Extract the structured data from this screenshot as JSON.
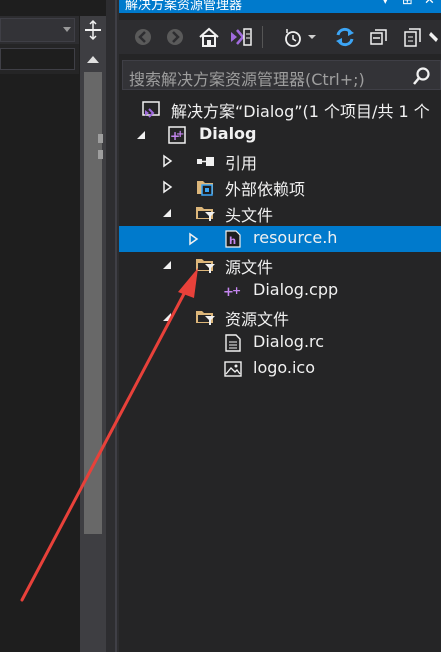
{
  "solution_explorer": {
    "title": "解决方案资源管理器",
    "title_controls": [
      "▾",
      "⊞",
      "✕"
    ],
    "search": {
      "placeholder": "搜索解决方案资源管理器(Ctrl+;)"
    },
    "tree": [
      {
        "label": "解决方案“Dialog”(1 个项目/共 1 个",
        "icon": "solution-icon"
      },
      {
        "label": "Dialog",
        "icon": "cpp-project-icon",
        "expanded": true
      },
      {
        "label": "引用",
        "icon": "references-icon",
        "expanded": false
      },
      {
        "label": "外部依赖项",
        "icon": "external-deps-icon",
        "expanded": false
      },
      {
        "label": "头文件",
        "icon": "folder-filter-icon",
        "expanded": true
      },
      {
        "label": "resource.h",
        "icon": "header-file-icon",
        "selected": true
      },
      {
        "label": "源文件",
        "icon": "folder-filter-icon",
        "expanded": true
      },
      {
        "label": "Dialog.cpp",
        "icon": "cpp-file-icon"
      },
      {
        "label": "资源文件",
        "icon": "folder-filter-icon",
        "expanded": true
      },
      {
        "label": "Dialog.rc",
        "icon": "rc-file-icon"
      },
      {
        "label": "logo.ico",
        "icon": "image-file-icon"
      }
    ]
  },
  "colors": {
    "accent": "#007acc",
    "panel": "#252526",
    "editor": "#1e1e1e",
    "annotation_arrow": "#e8413a"
  }
}
